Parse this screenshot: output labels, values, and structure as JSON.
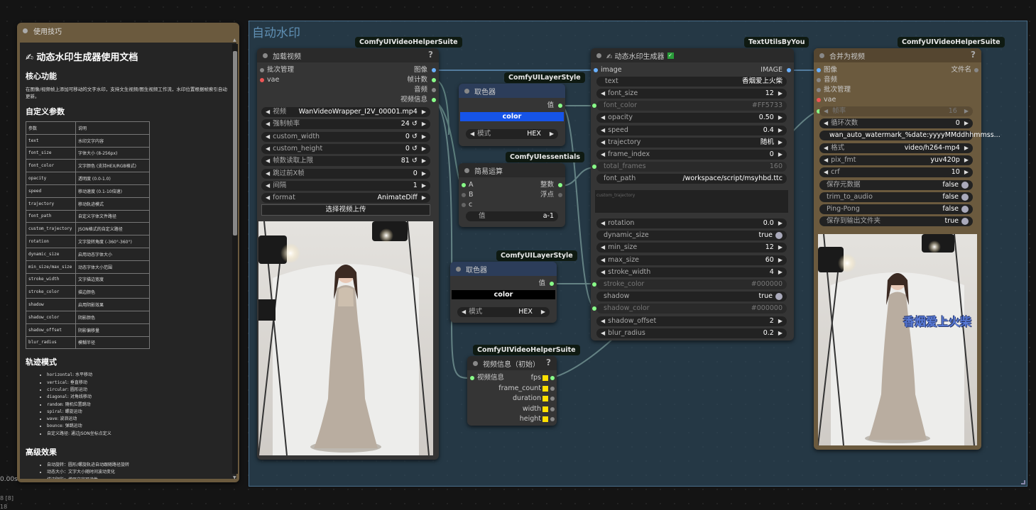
{
  "doc_node": {
    "title": "使用技巧",
    "heading": "✍ 动态水印生成器使用文档",
    "core_title": "核心功能",
    "core_text": "在图像/视频帧上添加可移动的文字水印，支持文生视频/图生视频工作流，水印位置根据帧索引自动更新。",
    "params_title": "自定义参数",
    "table_header": [
      "参数",
      "说明"
    ],
    "params": [
      [
        "text",
        "水印文字内容"
      ],
      [
        "font_size",
        "字体大小 (8-256px)"
      ],
      [
        "font_color",
        "文字颜色 (支持HEX/RGB格式)"
      ],
      [
        "opacity",
        "透明度 (0.0-1.0)"
      ],
      [
        "speed",
        "移动速度 (0.1-10倍速)"
      ],
      [
        "trajectory",
        "移动轨迹模式"
      ],
      [
        "font_path",
        "自定义字体文件路径"
      ],
      [
        "custom_trajectory",
        "JSON格式的自定义路径"
      ],
      [
        "rotation",
        "文字旋转角度 (-360°-360°)"
      ],
      [
        "dynamic_size",
        "启用动态字体大小"
      ],
      [
        "min_size/max_size",
        "动态字体大小范围"
      ],
      [
        "stroke_width",
        "文字描边宽度"
      ],
      [
        "stroke_color",
        "描边颜色"
      ],
      [
        "shadow",
        "启用阴影效果"
      ],
      [
        "shadow_color",
        "阴影颜色"
      ],
      [
        "shadow_offset",
        "阴影偏移量"
      ],
      [
        "blur_radius",
        "模糊半径"
      ]
    ],
    "traj_title": "轨迹模式",
    "traj_items": [
      [
        "horizontal",
        ": 水平移动"
      ],
      [
        "vertical",
        ": 垂直移动"
      ],
      [
        "circular",
        ": 圆形运动"
      ],
      [
        "diagonal",
        ": 对角线移动"
      ],
      [
        "random",
        ": 随机位置跳动"
      ],
      [
        "spiral",
        ": 螺旋运动"
      ],
      [
        "wave",
        ": 波浪运动"
      ],
      [
        "bounce",
        ": 弹跳运动"
      ],
      [
        "",
        "自定义路径: 通过JSON坐标点定义"
      ]
    ],
    "adv_title": "高级效果",
    "adv_items": [
      "自动旋转：圆形/螺旋轨迹自动跟随路径旋转",
      "动态大小：文字大小随时间波动变化",
      "描边阴影：增强文字可读性"
    ]
  },
  "status": {
    "time": "0.00s",
    "line1": "8 [8]",
    "line2": "18"
  },
  "group": {
    "title": "自动水印"
  },
  "load_video": {
    "badge": "ComfyUIVideoHelperSuite",
    "title": "加载视频",
    "inputs": [
      "批次管理",
      "vae"
    ],
    "outputs": [
      "图像",
      "帧计数",
      "音频",
      "视频信息"
    ],
    "widgets": [
      {
        "label": "视频",
        "value": "WanVideoWrapper_I2V_00001.mp4"
      },
      {
        "label": "强制帧率",
        "value": "24 ↺"
      },
      {
        "label": "custom_width",
        "value": "0 ↺"
      },
      {
        "label": "custom_height",
        "value": "0 ↺"
      },
      {
        "label": "帧数读取上限",
        "value": "81 ↺"
      },
      {
        "label": "跳过前X帧",
        "value": "0"
      },
      {
        "label": "间隔",
        "value": "1"
      },
      {
        "label": "format",
        "value": "AnimateDiff"
      }
    ],
    "upload_label": "选择视频上传"
  },
  "color_picker_1": {
    "badge": "ComfyUILayerStyle",
    "title": "取色器",
    "output": "值",
    "color_label": "color",
    "color_hex": "#1654e8",
    "mode_label": "模式",
    "mode_value": "HEX"
  },
  "math_node": {
    "badge": "ComfyUIessentials",
    "title": "简易运算",
    "inputs": [
      "A",
      "B",
      "c"
    ],
    "outputs": [
      "整数",
      "浮点"
    ],
    "value_label": "值",
    "value": "a-1"
  },
  "color_picker_2": {
    "badge": "ComfyUILayerStyle",
    "title": "取色器",
    "output": "值",
    "color_label": "color",
    "color_hex": "#000000",
    "mode_label": "模式",
    "mode_value": "HEX"
  },
  "video_info": {
    "badge": "ComfyUIVideoHelperSuite",
    "title": "视频信息（初始）",
    "input": "视频信息",
    "outputs": [
      "fps",
      "frame_count",
      "duration",
      "width",
      "height"
    ]
  },
  "watermark": {
    "badge": "TextUtilsByYou",
    "title": "✍ 动态水印生成器",
    "input": "image",
    "output": "IMAGE",
    "text_label": "text",
    "text_value": "香烟爱上火柴",
    "widgets_a": [
      {
        "label": "font_size",
        "value": "12",
        "dis": false
      },
      {
        "label": "font_color",
        "value": "#FF5733",
        "dis": true
      },
      {
        "label": "opacity",
        "value": "0.50",
        "dis": false
      },
      {
        "label": "speed",
        "value": "0.4",
        "dis": false
      },
      {
        "label": "trajectory",
        "value": "随机",
        "dis": false
      },
      {
        "label": "frame_index",
        "value": "0",
        "dis": false
      },
      {
        "label": "total_frames",
        "value": "160",
        "dis": true
      },
      {
        "label": "font_path",
        "value": "/workspace/script/msyhbd.ttc",
        "dis": false
      }
    ],
    "custom_traj_placeholder": "custom_trajectory",
    "widgets_b": [
      {
        "label": "rotation",
        "value": "0.0",
        "dis": false
      },
      {
        "label": "dynamic_size",
        "value": "true",
        "dis": false
      },
      {
        "label": "min_size",
        "value": "12",
        "dis": false
      },
      {
        "label": "max_size",
        "value": "60",
        "dis": false
      },
      {
        "label": "stroke_width",
        "value": "4",
        "dis": false
      },
      {
        "label": "stroke_color",
        "value": "#000000",
        "dis": true
      },
      {
        "label": "shadow",
        "value": "true",
        "dis": false
      },
      {
        "label": "shadow_color",
        "value": "#000000",
        "dis": true
      },
      {
        "label": "shadow_offset",
        "value": "2",
        "dis": false
      },
      {
        "label": "blur_radius",
        "value": "0.2",
        "dis": false
      }
    ]
  },
  "combine": {
    "badge": "ComfyUIVideoHelperSuite",
    "title": "合并为视频",
    "inputs": [
      "图像",
      "音频",
      "批次管理",
      "vae",
      "帧率"
    ],
    "output": "文件名",
    "frame_rate": "16",
    "widgets": [
      {
        "label": "循环次数",
        "value": "0"
      },
      {
        "label": "",
        "value": "wan_auto_watermark_%date:yyyyMMddhhmmss..."
      },
      {
        "label": "格式",
        "value": "video/h264-mp4"
      },
      {
        "label": "pix_fmt",
        "value": "yuv420p"
      },
      {
        "label": "crf",
        "value": "10"
      },
      {
        "label": "保存元数据",
        "value": "false"
      },
      {
        "label": "trim_to_audio",
        "value": "false"
      },
      {
        "label": "Ping-Pong",
        "value": "false"
      },
      {
        "label": "保存到输出文件夹",
        "value": "true"
      }
    ],
    "watermark_text": "香烟爱上火柴"
  }
}
